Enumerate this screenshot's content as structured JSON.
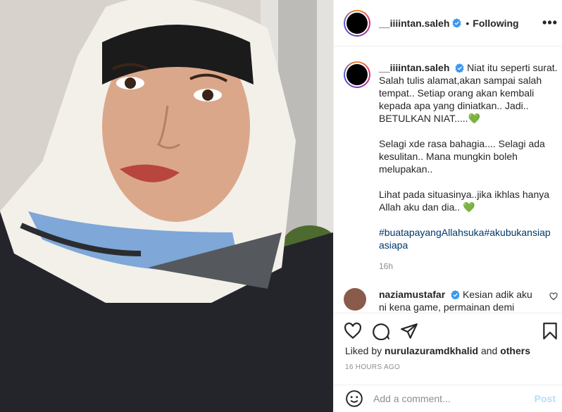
{
  "post": {
    "photo_alt_icon": "post-photo",
    "author": {
      "username": "__iiiintan.saleh",
      "verified_icon": "verified-badge-icon",
      "separator": "•",
      "follow_status": "Following"
    },
    "more_label": "•••",
    "caption": {
      "username": "__iiiintan.saleh",
      "paragraphs": [
        "Niat itu seperti surat. Salah tulis alamat,akan sampai salah tempat.. Setiap orang akan kembali kepada apa yang diniatkan.. Jadi.. BETULKAN NIAT.....💚",
        "Selagi xde rasa bahagia.... Selagi ada kesulitan.. Mana mungkin boleh melupakan..",
        "Lihat pada situasinya..jika ikhlas hanya Allah aku dan dia.. 💚"
      ],
      "hashtags": "#buatapayangAllahsuka#akubukansiap asiapa",
      "time": "16h"
    },
    "comment": {
      "username": "naziamustafar",
      "text": "Kesian adik aku ni kena game, permainan demi"
    },
    "likes": {
      "prefix": "Liked by",
      "user": "nurulazuramdkhalid",
      "conj": "and",
      "others": "others"
    },
    "timestamp": "16 HOURS AGO",
    "add_comment": {
      "placeholder": "Add a comment...",
      "post_label": "Post"
    },
    "colors": {
      "link": "#00376b",
      "muted": "#8e8e8e",
      "post_disabled": "#b2dffc",
      "verified": "#3897f0"
    }
  }
}
